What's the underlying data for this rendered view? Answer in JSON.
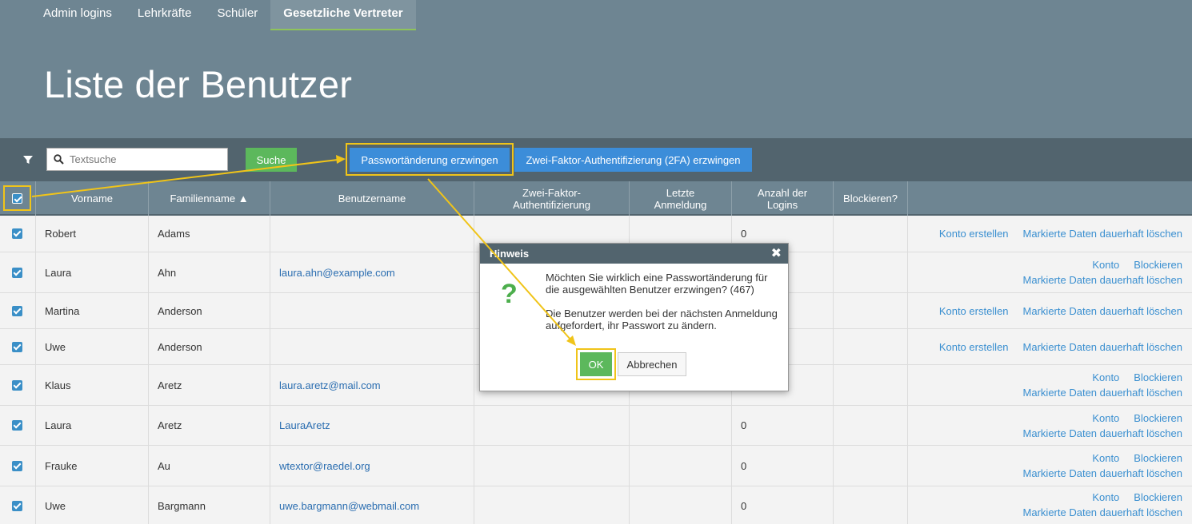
{
  "tabs": [
    {
      "label": "Admin logins"
    },
    {
      "label": "Lehrkräfte"
    },
    {
      "label": "Schüler"
    },
    {
      "label": "Gesetzliche Vertreter",
      "active": true
    }
  ],
  "page_title": "Liste der Benutzer",
  "toolbar": {
    "search_placeholder": "Textsuche",
    "search_button": "Suche",
    "force_password_button": "Passwortänderung erzwingen",
    "force_2fa_button": "Zwei-Faktor-Authentifizierung (2FA) erzwingen"
  },
  "columns": {
    "vorname": "Vorname",
    "familienname": "Familienname ▲",
    "benutzername": "Benutzername",
    "twofa_1": "Zwei-Faktor-",
    "twofa_2": "Authentifizierung",
    "last_1": "Letzte",
    "last_2": "Anmeldung",
    "count_1": "Anzahl der",
    "count_2": "Logins",
    "block": "Blockieren?"
  },
  "actions": {
    "create_account": "Konto erstellen",
    "delete_marked": "Markierte Daten dauerhaft löschen",
    "account": "Konto",
    "block": "Blockieren"
  },
  "rows": [
    {
      "first": "Robert",
      "last": "Adams",
      "user": "",
      "count": "0"
    },
    {
      "first": "Laura",
      "last": "Ahn",
      "user": "laura.ahn@example.com",
      "count": ""
    },
    {
      "first": "Martina",
      "last": "Anderson",
      "user": "",
      "count": ""
    },
    {
      "first": "Uwe",
      "last": "Anderson",
      "user": "",
      "count": ""
    },
    {
      "first": "Klaus",
      "last": "Aretz",
      "user": "laura.aretz@mail.com",
      "count": ""
    },
    {
      "first": "Laura",
      "last": "Aretz",
      "user": "LauraAretz",
      "count": "0"
    },
    {
      "first": "Frauke",
      "last": "Au",
      "user": "wtextor@raedel.org",
      "count": "0"
    },
    {
      "first": "Uwe",
      "last": "Bargmann",
      "user": "uwe.bargmann@webmail.com",
      "count": "0"
    }
  ],
  "dialog": {
    "title": "Hinweis",
    "close": "✖",
    "icon": "question-icon",
    "question": "?",
    "line1": "Möchten Sie wirklich eine Passwortänderung für die ausgewählten Benutzer erzwingen? (467)",
    "line2": "Die Benutzer werden bei der nächsten Anmeldung aufgefordert, ihr Passwort zu ändern.",
    "ok": "OK",
    "cancel": "Abbrechen"
  },
  "colors": {
    "header": "#6e8592",
    "toolbar": "#52646e",
    "primary": "#3c8dd9",
    "success": "#5cb85c",
    "highlight": "#f0c419"
  }
}
